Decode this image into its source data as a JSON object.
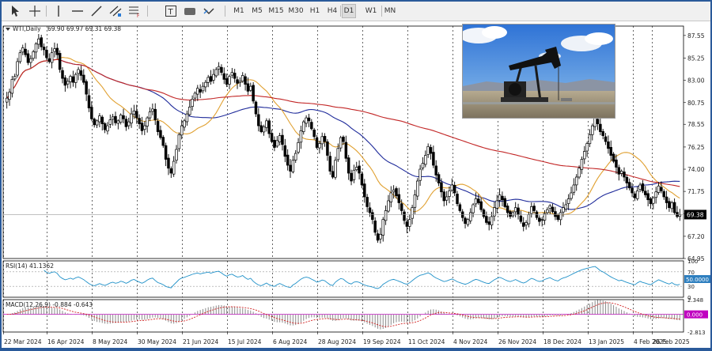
{
  "toolbar": {
    "tools": [
      {
        "name": "cursor-tool-button",
        "icon": "cursor-icon"
      },
      {
        "name": "crosshair-tool-button",
        "icon": "crosshair-icon"
      },
      {
        "name": "vertical-line-tool-button",
        "icon": "vertical-line-icon"
      },
      {
        "name": "horizontal-line-tool-button",
        "icon": "horizontal-line-icon"
      },
      {
        "name": "trendline-tool-button",
        "icon": "trendline-icon"
      },
      {
        "name": "equidistant-channel-tool-button",
        "icon": "channel-icon"
      },
      {
        "name": "fibonacci-tool-button",
        "icon": "fibonacci-icon"
      },
      {
        "name": "text-tool-button",
        "icon": "text-icon"
      },
      {
        "name": "rectangle-tool-button",
        "icon": "rectangle-icon"
      },
      {
        "name": "arrows-tool-button",
        "icon": "arrows-icon"
      }
    ],
    "timeframes": [
      "M1",
      "M5",
      "M15",
      "M30",
      "H1",
      "H4",
      "D1",
      "W1",
      "MN"
    ],
    "active_timeframe": "D1"
  },
  "chart_header": {
    "symbol": "WTI,Daily",
    "ohlc": "69.90 69.97 69.31 69.38"
  },
  "price_axis": {
    "labels": [
      "87.55",
      "85.25",
      "83.00",
      "80.75",
      "78.55",
      "76.25",
      "74.00",
      "71.75",
      "69.50",
      "67.20",
      "64.95"
    ],
    "last_price_label": "69.38"
  },
  "rsi": {
    "header": "RSI(14) 41.1362",
    "levels": [
      "100",
      "70",
      "50.0000",
      "30",
      "0"
    ]
  },
  "macd": {
    "header": "MACD(12,26,9) -0.884 -0.643",
    "axis": [
      "2.348",
      "0.000",
      "-2.813"
    ]
  },
  "time_axis": [
    "22 Mar 2024",
    "16 Apr 2024",
    "8 May 2024",
    "30 May 2024",
    "21 Jun 2024",
    "15 Jul 2024",
    "6 Aug 2024",
    "28 Aug 2024",
    "19 Sep 2024",
    "11 Oct 2024",
    "4 Nov 2024",
    "26 Nov 2024",
    "18 Dec 2024",
    "13 Jan 2025",
    "4 Feb 2025",
    "26 Feb 2025"
  ],
  "chart_data": {
    "type": "candlestick",
    "symbol": "WTI",
    "timeframe": "Daily",
    "ylim": [
      64.95,
      88.5
    ],
    "close": [
      81.2,
      81.8,
      83.1,
      83.4,
      84.9,
      85.8,
      86.3,
      85.6,
      84.8,
      85.2,
      85.9,
      86.7,
      87.2,
      86.4,
      86.1,
      85.3,
      84.9,
      85.8,
      86.2,
      85.6,
      84.1,
      83.2,
      82.5,
      82.9,
      83.4,
      82.8,
      83.6,
      84.1,
      83.5,
      82.8,
      81.6,
      80.2,
      79.1,
      78.5,
      78.9,
      79.4,
      78.6,
      78.0,
      78.4,
      79.0,
      79.3,
      78.7,
      78.9,
      79.5,
      79.1,
      78.3,
      78.8,
      79.6,
      79.9,
      79.2,
      78.6,
      77.9,
      78.4,
      79.2,
      79.8,
      80.1,
      79.0,
      77.8,
      77.2,
      76.4,
      75.0,
      74.1,
      73.6,
      74.8,
      76.0,
      77.5,
      78.4,
      78.9,
      79.6,
      80.3,
      81.1,
      81.7,
      82.2,
      81.8,
      82.4,
      82.8,
      83.3,
      82.9,
      83.6,
      84.1,
      84.4,
      83.8,
      83.1,
      82.6,
      83.4,
      83.8,
      83.2,
      82.7,
      82.9,
      83.5,
      82.6,
      81.9,
      82.4,
      80.9,
      79.6,
      78.4,
      77.8,
      78.3,
      78.9,
      77.6,
      76.8,
      76.2,
      76.9,
      77.4,
      76.5,
      75.3,
      74.4,
      73.8,
      74.9,
      75.6,
      76.7,
      77.9,
      78.8,
      79.2,
      78.9,
      78.1,
      77.3,
      76.2,
      76.6,
      77.3,
      76.8,
      75.4,
      73.8,
      73.2,
      74.9,
      76.1,
      77.2,
      76.8,
      75.1,
      73.6,
      72.8,
      73.9,
      74.2,
      73.6,
      72.4,
      71.2,
      70.2,
      69.6,
      68.9,
      67.6,
      66.8,
      67.4,
      68.9,
      69.8,
      70.8,
      71.6,
      71.9,
      71.3,
      70.6,
      69.8,
      68.8,
      68.2,
      68.9,
      70.1,
      71.4,
      72.8,
      74.0,
      74.6,
      75.4,
      76.3,
      75.6,
      74.4,
      73.4,
      72.6,
      71.7,
      70.8,
      71.2,
      71.8,
      72.4,
      71.6,
      70.5,
      69.8,
      69.1,
      68.5,
      68.9,
      69.6,
      70.4,
      71.0,
      70.6,
      69.9,
      69.2,
      68.6,
      68.4,
      69.2,
      70.1,
      70.8,
      71.4,
      70.9,
      70.2,
      69.6,
      69.2,
      69.6,
      70.1,
      69.4,
      68.7,
      68.2,
      68.6,
      69.4,
      70.2,
      69.8,
      69.1,
      68.7,
      68.9,
      69.5,
      69.9,
      70.3,
      69.7,
      69.2,
      68.9,
      69.6,
      70.1,
      70.4,
      71.0,
      71.6,
      72.4,
      73.2,
      74.1,
      75.0,
      75.8,
      76.6,
      77.5,
      78.4,
      79.2,
      78.6,
      77.8,
      77.4,
      76.8,
      76.1,
      75.4,
      74.8,
      74.2,
      73.5,
      73.8,
      73.2,
      72.6,
      72.1,
      71.6,
      71.1,
      71.8,
      72.4,
      71.8,
      71.4,
      70.9,
      70.5,
      71.1,
      71.7,
      72.3,
      71.8,
      71.2,
      70.6,
      70.1,
      70.6,
      69.6,
      69.2,
      69.4
    ],
    "moving_averages": [
      {
        "color": "#1e2a9a"
      },
      {
        "color": "#e0a030"
      },
      {
        "color": "#c22525"
      }
    ],
    "rsi_period": 14,
    "macd_params": [
      12,
      26,
      9
    ]
  },
  "colors": {
    "background": "#ffffff",
    "candle": "#000000",
    "grid": "#000000",
    "rsi_line": "#1e90c8",
    "macd_zero": "#c000c0",
    "macd_signal": "#d02020"
  }
}
